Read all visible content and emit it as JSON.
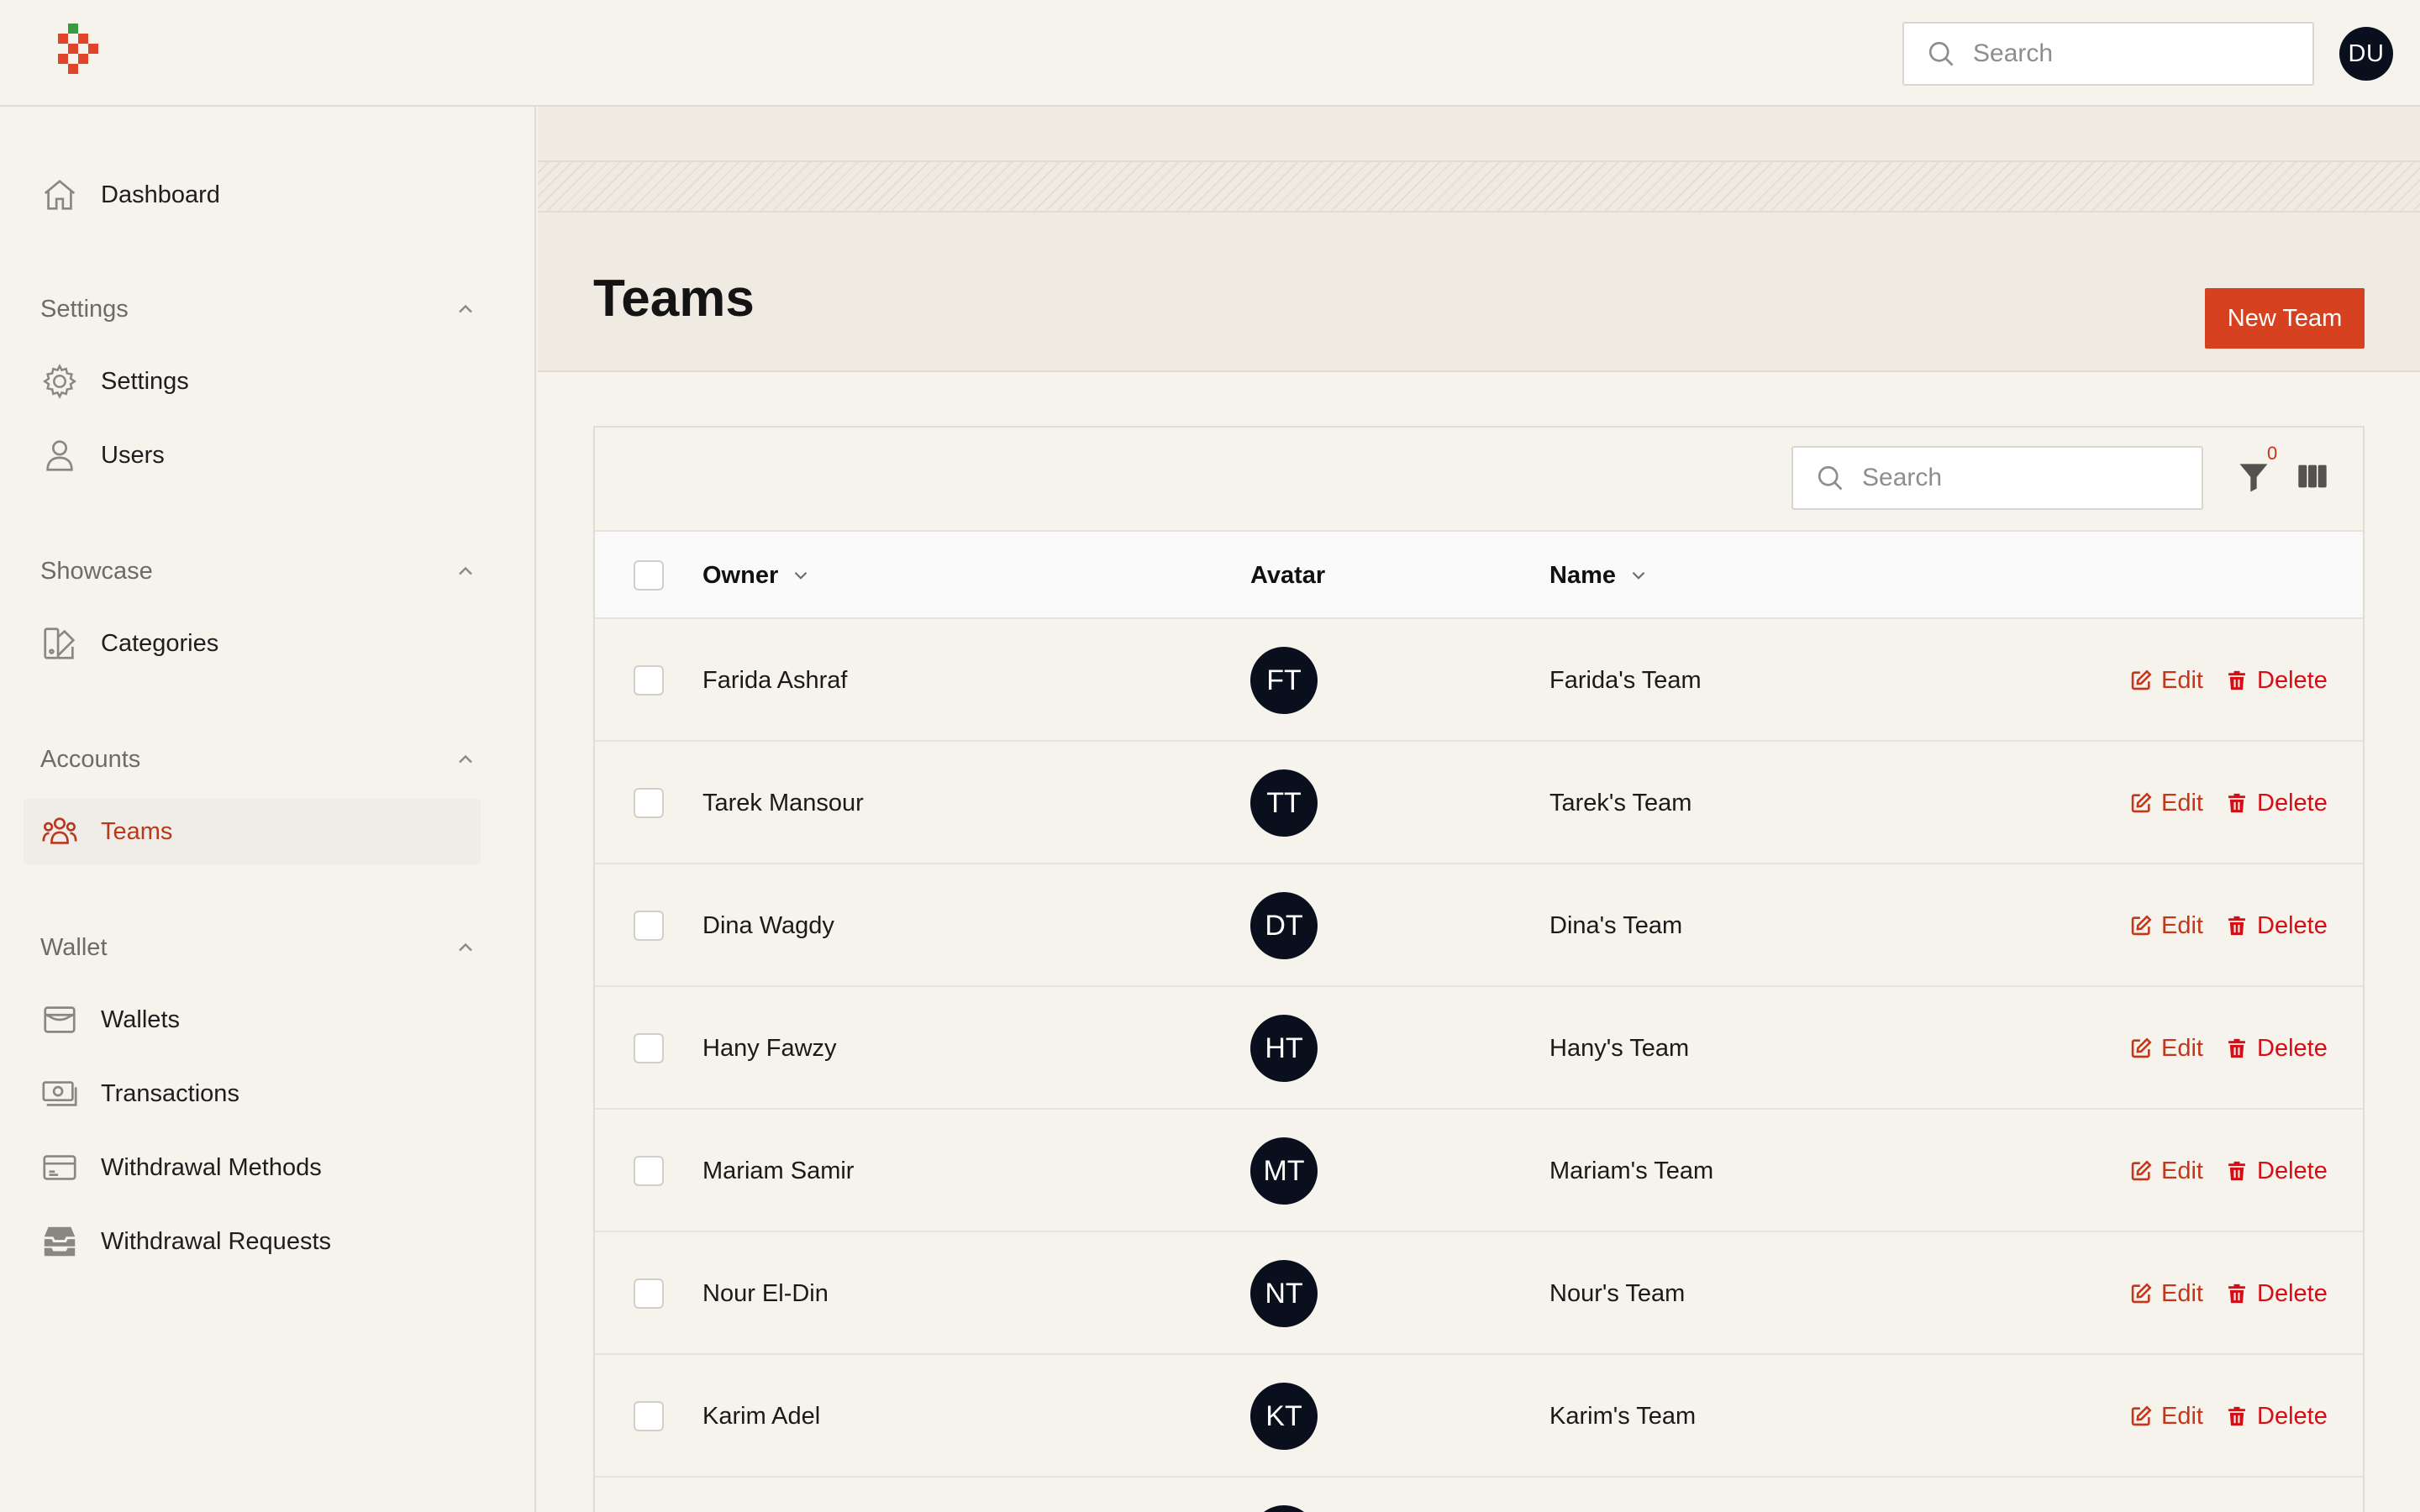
{
  "header": {
    "search_placeholder": "Search",
    "user_initials": "DU"
  },
  "sidebar": {
    "dashboard": "Dashboard",
    "groups": [
      {
        "label": "Settings",
        "items": [
          "Settings",
          "Users"
        ]
      },
      {
        "label": "Showcase",
        "items": [
          "Categories"
        ]
      },
      {
        "label": "Accounts",
        "items": [
          "Teams"
        ]
      },
      {
        "label": "Wallet",
        "items": [
          "Wallets",
          "Transactions",
          "Withdrawal Methods",
          "Withdrawal Requests"
        ]
      }
    ],
    "active_item": "Teams"
  },
  "page": {
    "title": "Teams",
    "new_button": "New Team"
  },
  "table": {
    "search_placeholder": "Search",
    "filter_count": "0",
    "columns": {
      "owner": "Owner",
      "avatar": "Avatar",
      "name": "Name"
    },
    "edit_label": "Edit",
    "delete_label": "Delete",
    "rows": [
      {
        "owner": "Farida Ashraf",
        "initials": "FT",
        "name": "Farida's Team"
      },
      {
        "owner": "Tarek Mansour",
        "initials": "TT",
        "name": "Tarek's Team"
      },
      {
        "owner": "Dina Wagdy",
        "initials": "DT",
        "name": "Dina's Team"
      },
      {
        "owner": "Hany Fawzy",
        "initials": "HT",
        "name": "Hany's Team"
      },
      {
        "owner": "Mariam Samir",
        "initials": "MT",
        "name": "Mariam's Team"
      },
      {
        "owner": "Nour El-Din",
        "initials": "NT",
        "name": "Nour's Team"
      },
      {
        "owner": "Karim Adel",
        "initials": "KT",
        "name": "Karim's Team"
      }
    ]
  },
  "colors": {
    "brand": "#d6411f",
    "active_nav": "#b8391c",
    "delete": "#d60d14",
    "avatar_bg": "#0a0f1e"
  }
}
